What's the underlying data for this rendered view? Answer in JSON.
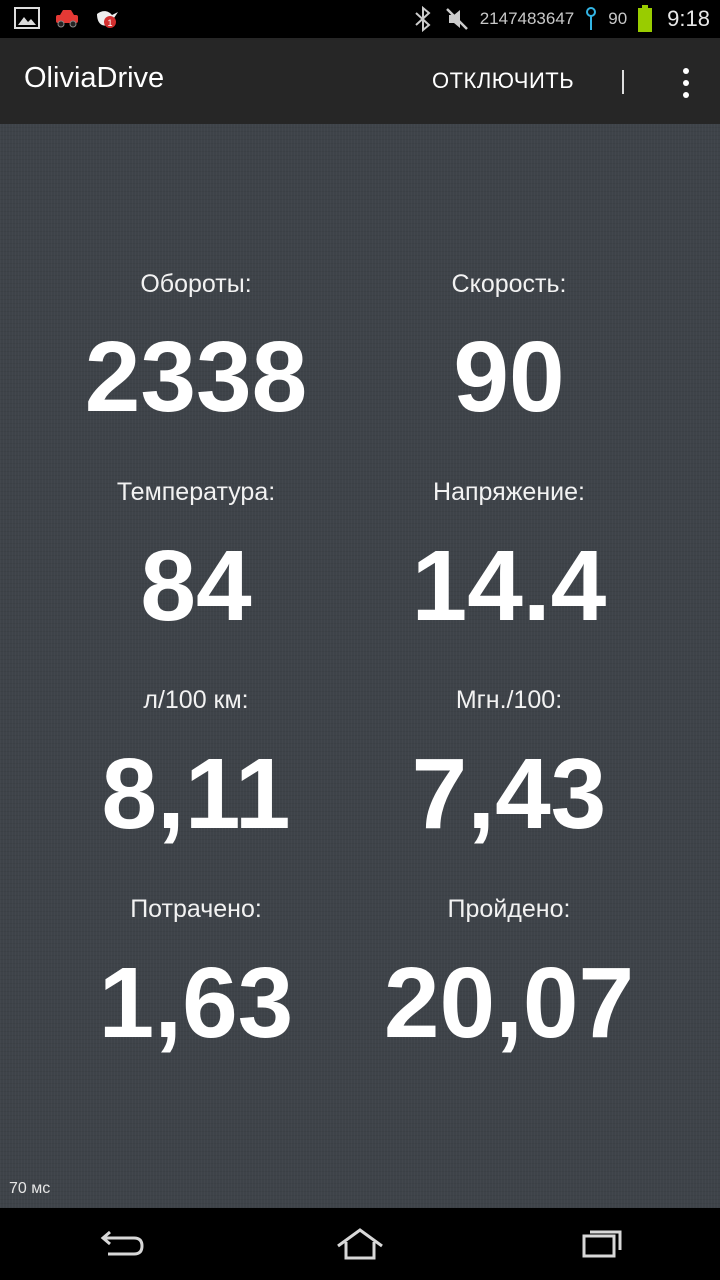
{
  "status_bar": {
    "notification_icons": [
      "image-icon",
      "car-icon",
      "bird-notification-icon"
    ],
    "signal_text": "2147483647",
    "battery_level": "90",
    "clock": "9:18"
  },
  "action_bar": {
    "title": "OliviaDrive",
    "disconnect_label": "ОТКЛЮЧИТЬ",
    "divider_glyph": "|"
  },
  "metrics": {
    "rpm": {
      "label": "Обороты:",
      "value": "2338"
    },
    "speed": {
      "label": "Скорость:",
      "value": "90"
    },
    "temperature": {
      "label": "Температура:",
      "value": "84"
    },
    "voltage": {
      "label": "Напряжение:",
      "value": "14.4"
    },
    "avg_consumption": {
      "label": "л/100 км:",
      "value": "8,11"
    },
    "instant_consumption": {
      "label": "Мгн./100:",
      "value": "7,43"
    },
    "spent": {
      "label": "Потрачено:",
      "value": "1,63"
    },
    "traveled": {
      "label": "Пройдено:",
      "value": "20,07"
    }
  },
  "latency": "70 мс",
  "nav_bar": {
    "icons": [
      "back-icon",
      "home-icon",
      "recent-apps-icon"
    ]
  },
  "colors": {
    "background": "#3e4349",
    "actionbar": "#262626",
    "battery": "#99cc00",
    "signal": "#33b5e5"
  }
}
